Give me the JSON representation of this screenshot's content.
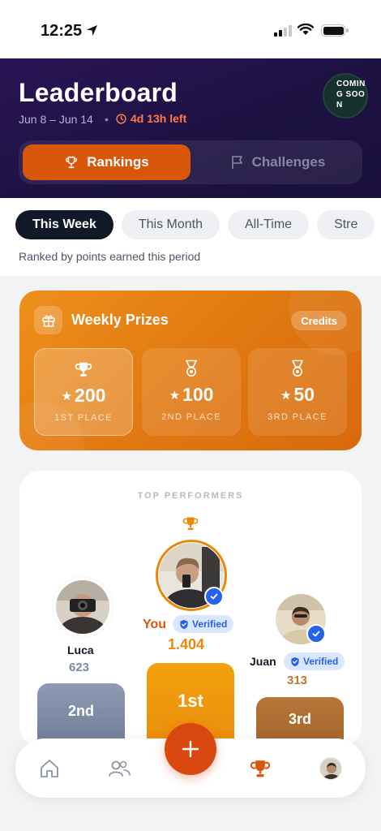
{
  "status_bar": {
    "time": "12:25"
  },
  "header": {
    "title": "Leaderboard",
    "date_range": "Jun 8 – Jun 14",
    "separator": "•",
    "time_left": "4d 13h left",
    "coming_soon": "COMING SOON",
    "tabs": [
      {
        "label": "Rankings",
        "icon": "trophy-icon",
        "active": true
      },
      {
        "label": "Challenges",
        "icon": "flag-icon",
        "active": false
      }
    ]
  },
  "filters": {
    "chips": [
      {
        "label": "This Week",
        "active": true
      },
      {
        "label": "This Month",
        "active": false
      },
      {
        "label": "All-Time",
        "active": false
      },
      {
        "label": "Stre",
        "active": false
      }
    ],
    "note": "Ranked by points earned this period"
  },
  "prizes": {
    "title": "Weekly Prizes",
    "badge": "Credits",
    "items": [
      {
        "amount": "200",
        "place": "1ST PLACE",
        "icon": "trophy-icon"
      },
      {
        "amount": "100",
        "place": "2ND PLACE",
        "icon": "medal-icon"
      },
      {
        "amount": "50",
        "place": "3RD PLACE",
        "icon": "medal-icon"
      }
    ],
    "star": "★"
  },
  "performers": {
    "title": "TOP PERFORMERS",
    "verified_label": "Verified",
    "people": [
      {
        "rank": "2nd",
        "name": "Luca",
        "points": "623"
      },
      {
        "rank": "1st",
        "name": "You",
        "points": "1.404"
      },
      {
        "rank": "3rd",
        "name": "Juan",
        "points": "313"
      }
    ]
  },
  "colors": {
    "accent": "#d9560a",
    "header_bg": "#1d1242",
    "gold": "#e8890c",
    "silver": "#7c8aa5",
    "bronze": "#a86a2c",
    "verified_blue": "#2563eb"
  },
  "nav": {
    "items": [
      "home-icon",
      "friends-icon",
      "add-icon",
      "trophy-icon",
      "profile-avatar"
    ]
  }
}
